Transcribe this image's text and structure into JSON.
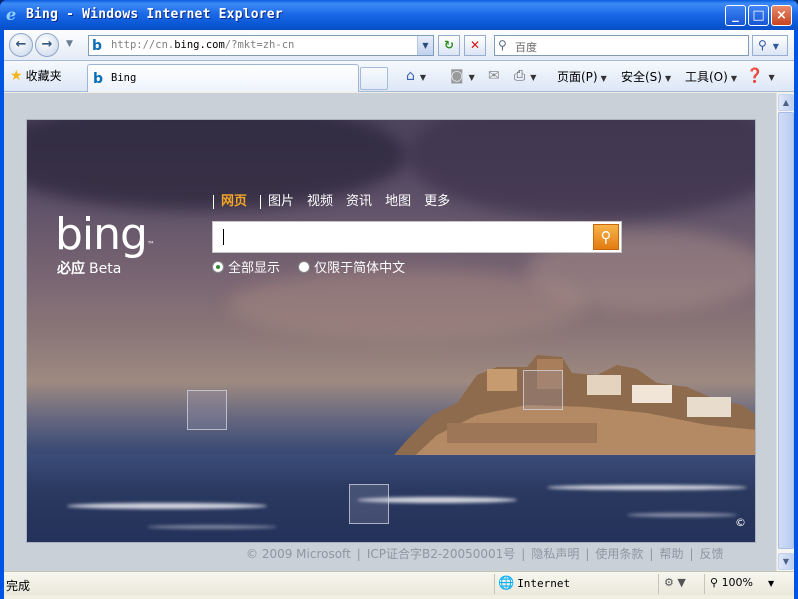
{
  "window": {
    "title": "Bing - Windows Internet Explorer",
    "min_symbol": "_",
    "max_symbol": "□",
    "close_symbol": "×"
  },
  "address": {
    "url_prefix": "http://cn.",
    "url_domain": "bing.com",
    "url_suffix": "/?mkt=zh-cn",
    "search_placeholder": "百度"
  },
  "tabbar": {
    "favorites_label": "收藏夹",
    "tab_title": "Bing",
    "page_menu": "页面(P)",
    "safety_menu": "安全(S)",
    "tools_menu": "工具(O)"
  },
  "bing": {
    "logo_text": "bing",
    "logo_cn": "必应",
    "logo_beta": "Beta",
    "scopes": [
      "网页",
      "图片",
      "视频",
      "资讯",
      "地图",
      "更多"
    ],
    "options": [
      "全部显示",
      "仅限于简体中文"
    ],
    "copyright_mark": "©"
  },
  "footer": {
    "copyright": "© 2009 Microsoft",
    "icp": "ICP证合字B2-20050001号",
    "privacy": "隐私声明",
    "terms": "使用条款",
    "help": "帮助",
    "feedback": "反馈"
  },
  "statusbar": {
    "status": "完成",
    "zone": "Internet",
    "zoom": "100%"
  },
  "colors": {
    "title_blue": "#0a58d6",
    "bing_accent": "#f4a527"
  }
}
